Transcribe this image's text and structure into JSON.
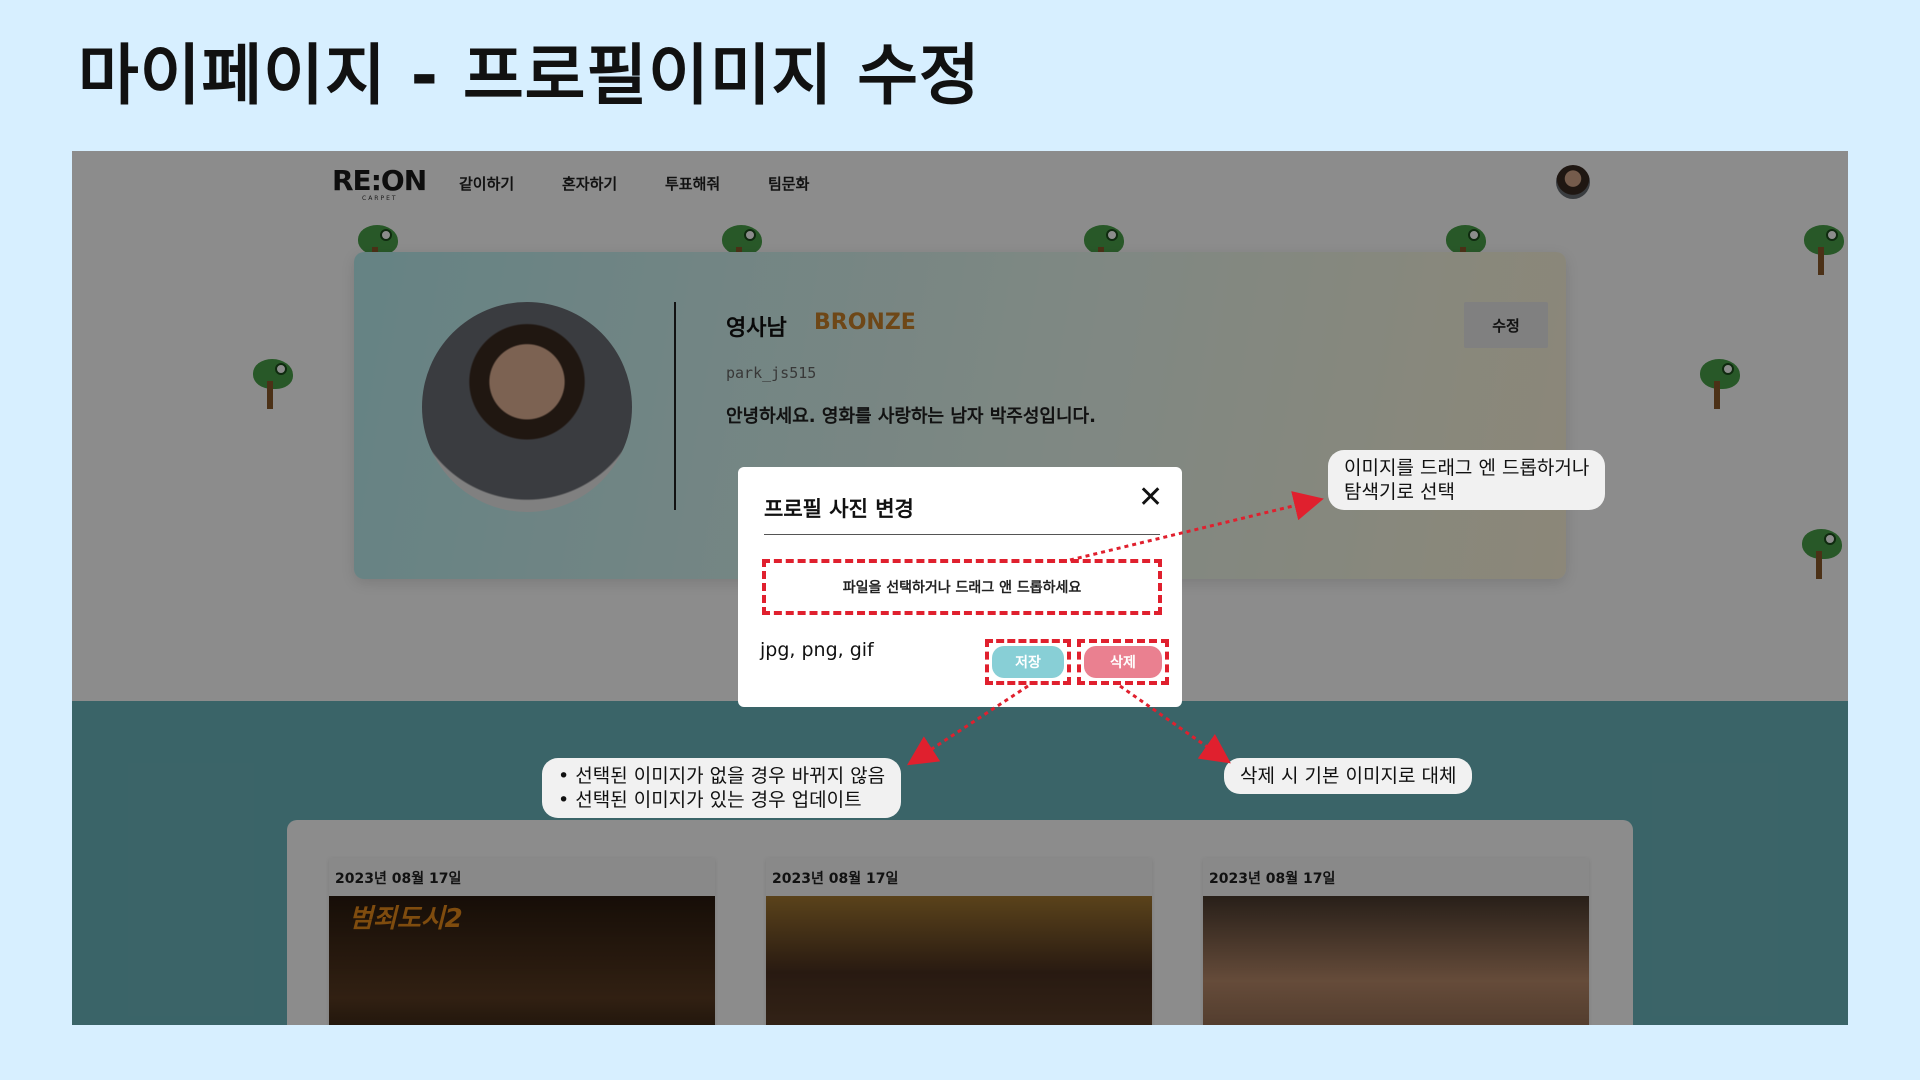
{
  "slide": {
    "title": "마이페이지 - 프로필이미지 수정"
  },
  "nav": {
    "logo": "RE:ON",
    "logo_sub": "CARPET",
    "items": [
      "같이하기",
      "혼자하기",
      "투표해줘",
      "팀문화"
    ]
  },
  "profile": {
    "name": "영사남",
    "rank": "BRONZE",
    "user_id": "park_js515",
    "bio": "안녕하세요. 영화를 사랑하는 남자 박주성입니다.",
    "edit_label": "수정"
  },
  "reviews": [
    {
      "date": "2023년 08월 17일",
      "poster_text": "범죄도시2"
    },
    {
      "date": "2023년 08월 17일",
      "poster_text": ""
    },
    {
      "date": "2023년 08월 17일",
      "poster_text": ""
    }
  ],
  "modal": {
    "title": "프로필 사진 변경",
    "close_glyph": "✕",
    "dropzone_text": "파일을 선택하거나 드래그 앤 드롭하세요",
    "formats": "jpg, png, gif",
    "save_label": "저장",
    "delete_label": "삭제"
  },
  "callouts": {
    "dropzone_note_line1": "이미지를 드래그 엔 드롭하거나",
    "dropzone_note_line2": "탐색기로 선택",
    "save_note_line1": "• 선택된 이미지가 없을 경우 바뀌지 않음",
    "save_note_line2": "• 선택된 이미지가 있는 경우 업데이트",
    "delete_note": "삭제 시 기본 이미지로 대체"
  },
  "colors": {
    "background": "#d7efff",
    "accent_dashed": "#e0202e",
    "rank": "#c9812a",
    "save_button": "#88cfd6",
    "delete_button": "#ea8090",
    "teal_section": "#6bb7bd"
  }
}
